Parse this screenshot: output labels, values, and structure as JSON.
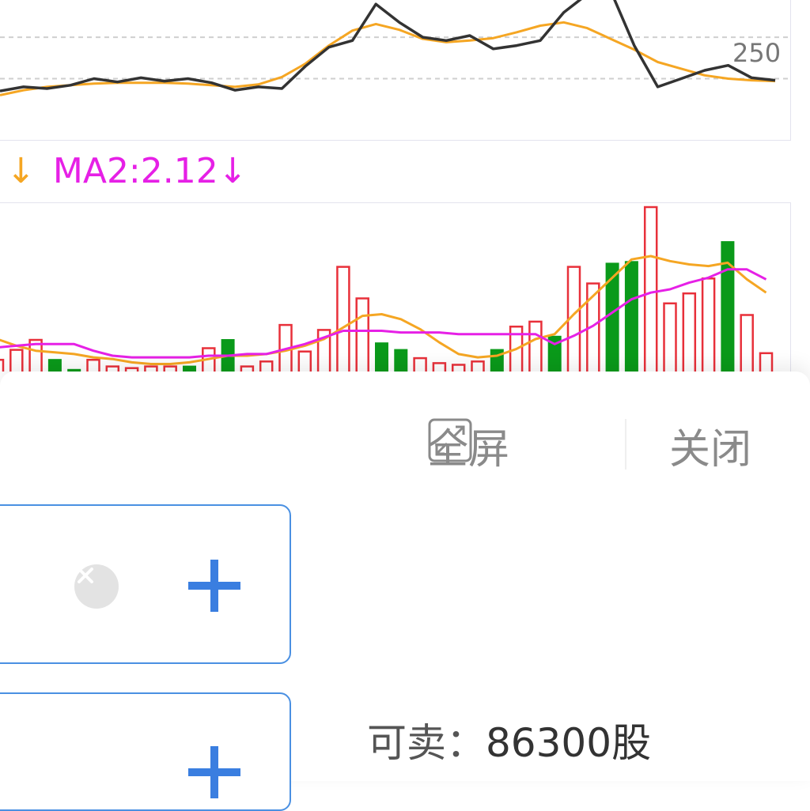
{
  "chart": {
    "axis_label": "250",
    "legend": {
      "ma1_arrow": "↓",
      "ma2_text": "MA2:2.12",
      "ma2_arrow": "↓",
      "colors": {
        "ma1": "#f5a623",
        "ma2": "#e620e6"
      }
    }
  },
  "chart_data": {
    "type": "bar",
    "volume": [
      {
        "value": 0.8,
        "color": "up"
      },
      {
        "value": 1.4,
        "color": "up"
      },
      {
        "value": 2.0,
        "color": "up"
      },
      {
        "value": 0.8,
        "color": "down"
      },
      {
        "value": 0.2,
        "color": "down"
      },
      {
        "value": 0.8,
        "color": "up"
      },
      {
        "value": 0.4,
        "color": "up"
      },
      {
        "value": 0.3,
        "color": "up"
      },
      {
        "value": 0.4,
        "color": "up"
      },
      {
        "value": 0.4,
        "color": "up"
      },
      {
        "value": 0.4,
        "color": "down"
      },
      {
        "value": 1.5,
        "color": "up"
      },
      {
        "value": 2.0,
        "color": "down"
      },
      {
        "value": 0.4,
        "color": "up"
      },
      {
        "value": 0.7,
        "color": "up"
      },
      {
        "value": 2.9,
        "color": "up"
      },
      {
        "value": 1.3,
        "color": "up"
      },
      {
        "value": 2.6,
        "color": "up"
      },
      {
        "value": 6.4,
        "color": "up"
      },
      {
        "value": 4.5,
        "color": "up"
      },
      {
        "value": 1.8,
        "color": "down"
      },
      {
        "value": 1.4,
        "color": "down"
      },
      {
        "value": 0.9,
        "color": "up"
      },
      {
        "value": 0.6,
        "color": "up"
      },
      {
        "value": 0.5,
        "color": "up"
      },
      {
        "value": 0.7,
        "color": "up"
      },
      {
        "value": 1.4,
        "color": "down"
      },
      {
        "value": 2.8,
        "color": "up"
      },
      {
        "value": 3.1,
        "color": "up"
      },
      {
        "value": 2.2,
        "color": "down"
      },
      {
        "value": 6.4,
        "color": "up"
      },
      {
        "value": 5.4,
        "color": "up"
      },
      {
        "value": 6.6,
        "color": "down"
      },
      {
        "value": 6.7,
        "color": "down"
      },
      {
        "value": 10.0,
        "color": "up"
      },
      {
        "value": 4.2,
        "color": "up"
      },
      {
        "value": 4.8,
        "color": "up"
      },
      {
        "value": 5.7,
        "color": "up"
      },
      {
        "value": 7.9,
        "color": "down"
      },
      {
        "value": 3.5,
        "color": "up"
      },
      {
        "value": 1.2,
        "color": "up"
      }
    ],
    "volume_ma1": [
      2.0,
      1.6,
      1.3,
      1.2,
      1.1,
      0.9,
      0.8,
      0.6,
      0.5,
      0.5,
      0.6,
      0.8,
      1.0,
      1.0,
      1.1,
      1.3,
      1.6,
      2.0,
      2.7,
      3.4,
      3.5,
      3.2,
      2.6,
      1.8,
      1.1,
      0.9,
      1.0,
      1.4,
      2.0,
      2.3,
      3.5,
      4.6,
      5.7,
      6.8,
      7.0,
      6.7,
      6.5,
      6.4,
      6.6,
      5.6,
      4.8
    ],
    "volume_ma2": [
      1.5,
      1.6,
      1.7,
      1.7,
      1.7,
      1.3,
      1.0,
      0.9,
      0.9,
      0.9,
      0.9,
      1.0,
      1.0,
      1.1,
      1.1,
      1.4,
      1.7,
      2.1,
      2.5,
      2.5,
      2.5,
      2.4,
      2.4,
      2.4,
      2.3,
      2.3,
      2.3,
      2.3,
      2.3,
      1.7,
      2.2,
      2.8,
      3.6,
      4.4,
      4.8,
      5.0,
      5.4,
      5.7,
      6.2,
      6.2,
      5.6
    ],
    "price": [
      235,
      240,
      238,
      242,
      250,
      246,
      251,
      247,
      250,
      245,
      236,
      240,
      238,
      265,
      288,
      296,
      340,
      318,
      300,
      296,
      302,
      286,
      290,
      296,
      330,
      352,
      356,
      290,
      240,
      250,
      260,
      266,
      251,
      248
    ],
    "price_ma": [
      230,
      236,
      240,
      242,
      244,
      245,
      245,
      245,
      244,
      242,
      240,
      243,
      252,
      268,
      290,
      308,
      316,
      309,
      298,
      294,
      296,
      299,
      306,
      314,
      318,
      311,
      298,
      285,
      270,
      262,
      254,
      250,
      248,
      247
    ]
  },
  "toolbar": {
    "fullscreen_label": "全屏",
    "close_label": "关闭"
  },
  "form": {
    "sellable_label": "可卖：",
    "sellable_value": "86300",
    "sellable_unit": "股",
    "accent_color": "#4a90e2",
    "plus_color": "#3a7ee0"
  }
}
